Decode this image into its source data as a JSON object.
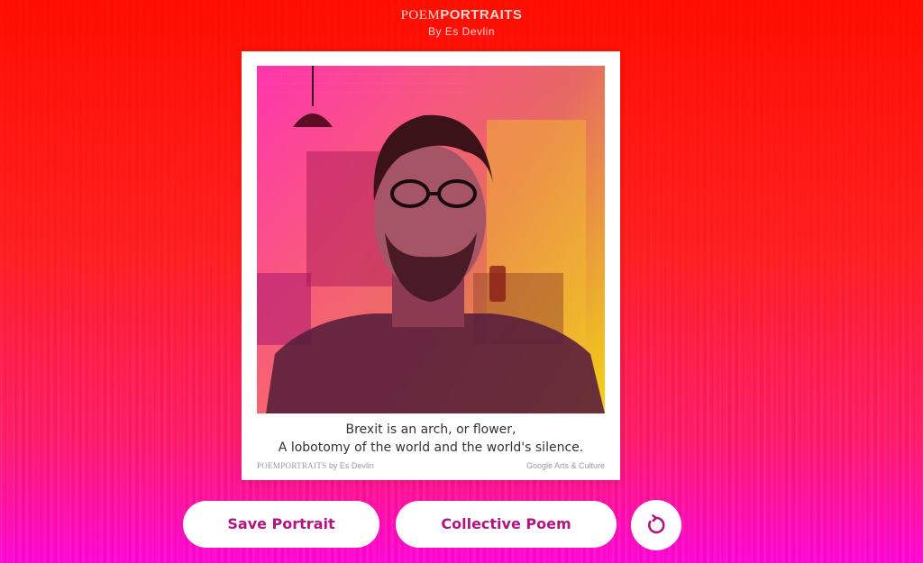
{
  "header": {
    "brand_thin": "POEM",
    "brand_bold": "PORTRAITS",
    "byline": "By Es Devlin"
  },
  "card": {
    "poem_line_1": "Brexit is an arch, or flower,",
    "poem_line_2": "A lobotomy of the world and the world's silence.",
    "footer_brand_thin": "POEM",
    "footer_brand_bold": "PORTRAITS",
    "footer_by": " by Es Devlin",
    "footer_right": "Google Arts & Culture"
  },
  "actions": {
    "save_label": "Save Portrait",
    "collective_label": "Collective Poem",
    "reload_icon": "refresh-icon"
  },
  "colors": {
    "accent": "#b0167e",
    "bg_top": "#ff0d00",
    "bg_bottom": "#ff00d8"
  }
}
